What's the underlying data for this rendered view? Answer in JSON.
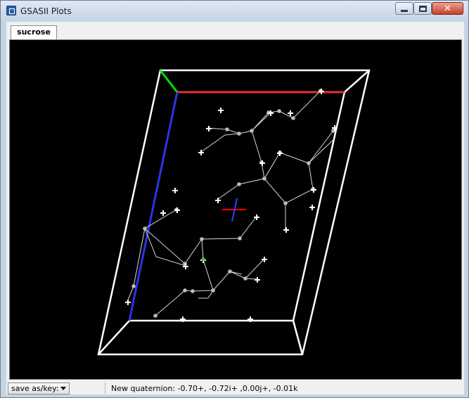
{
  "window": {
    "title": "GSASII Plots",
    "minimize_label": "",
    "maximize_label": "",
    "close_label": "✕"
  },
  "tabs": [
    {
      "label": "sucrose"
    }
  ],
  "plot": {
    "description_shown": "3D crystal structure drawing of sucrose inside a unit cell",
    "axis_colors": {
      "a": "#ff0000",
      "b": "#00ff00",
      "c": "#0000ff"
    },
    "cell_color": "#ffffff",
    "background": "#000000"
  },
  "statusbar": {
    "save_select": {
      "selected": "save as/key:"
    },
    "message": "New quaternion: -0.70+, -0.72i+ ,0.00j+, -0.01k"
  }
}
